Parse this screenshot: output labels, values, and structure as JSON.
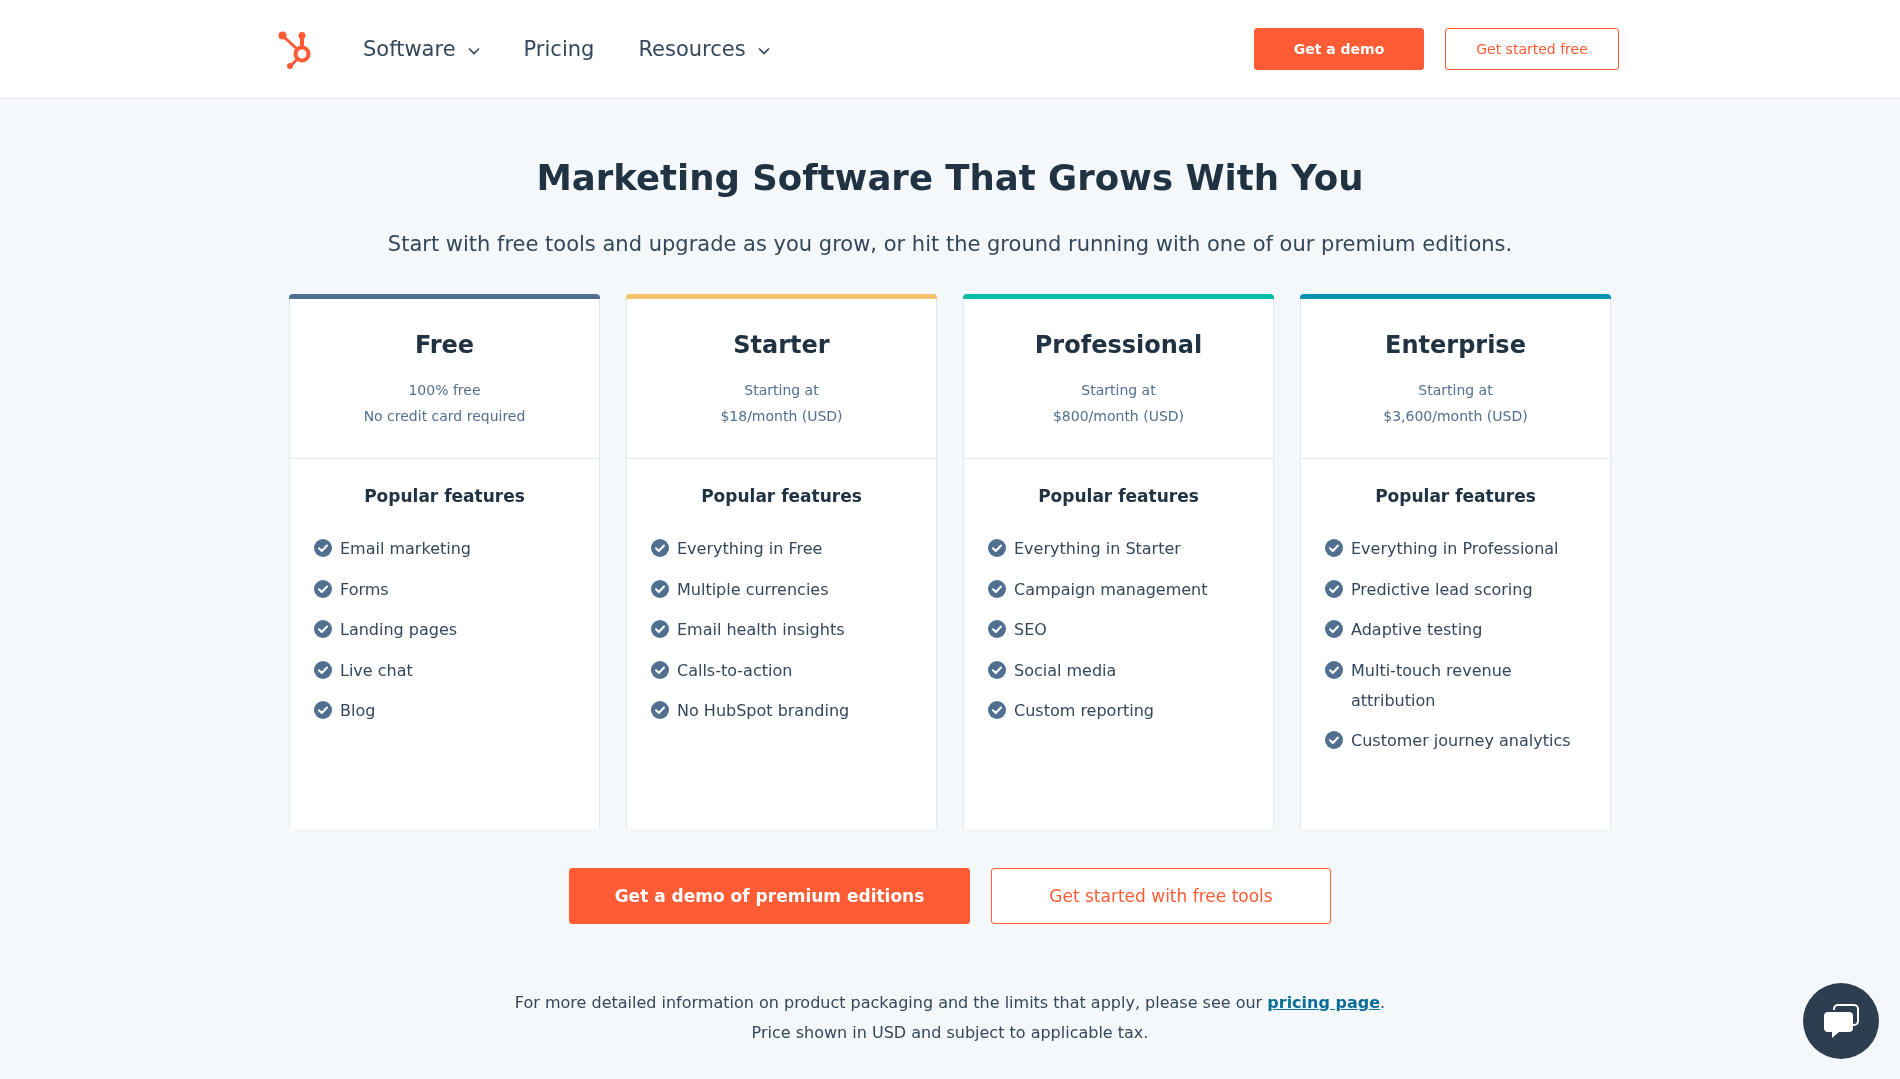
{
  "header": {
    "nav": [
      {
        "label": "Software",
        "dropdown": true
      },
      {
        "label": "Pricing",
        "dropdown": false
      },
      {
        "label": "Resources",
        "dropdown": true
      }
    ],
    "buttons": [
      {
        "label": "Get a demo",
        "kind": "primary"
      },
      {
        "label": "Get started free",
        "kind": "secondary"
      }
    ]
  },
  "hero": {
    "title": "Marketing Software That Grows With You",
    "subtitle": "Start with free tools and upgrade as you grow, or hit the ground running with one of our premium editions."
  },
  "plans": [
    {
      "name": "Free",
      "color": "#516f90",
      "lines": [
        "100% free",
        "No credit card required"
      ],
      "features_title": "Popular features",
      "features": [
        "Email marketing",
        "Forms",
        "Landing pages",
        "Live chat",
        "Blog"
      ]
    },
    {
      "name": "Starter",
      "color": "#f5c26b",
      "lines": [
        "Starting at",
        "$18/month (USD)"
      ],
      "features_title": "Popular features",
      "features": [
        "Everything in Free",
        "Multiple currencies",
        "Email health insights",
        "Calls-to-action",
        "No HubSpot branding"
      ]
    },
    {
      "name": "Professional",
      "color": "#00bda5",
      "lines": [
        "Starting at",
        "$800/month (USD)"
      ],
      "features_title": "Popular features",
      "features": [
        "Everything in Starter",
        "Campaign management",
        "SEO",
        "Social media",
        "Custom reporting"
      ]
    },
    {
      "name": "Enterprise",
      "color": "#0091ae",
      "lines": [
        "Starting at",
        "$3,600/month (USD)"
      ],
      "features_title": "Popular features",
      "features": [
        "Everything in Professional",
        "Predictive lead scoring",
        "Adaptive testing",
        "Multi-touch revenue attribution",
        "Customer journey analytics"
      ]
    }
  ],
  "actions": [
    {
      "label": "Get a demo of premium editions",
      "kind": "primary"
    },
    {
      "label": "Get started with free tools",
      "kind": "secondary"
    }
  ],
  "footnote": {
    "text_before": "For more detailed information on product packaging and the limits that apply, please see our ",
    "link": "pricing page",
    "text_after": ".",
    "note": "Price shown in USD and subject to applicable tax."
  }
}
